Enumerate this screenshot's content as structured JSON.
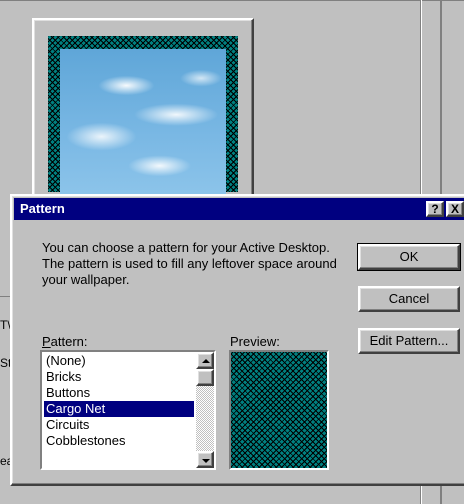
{
  "background": {
    "fragments": [
      "T\\",
      "St",
      "ea"
    ]
  },
  "dialog": {
    "title": "Pattern",
    "help_glyph": "?",
    "close_glyph": "X",
    "description": "You can choose a pattern for your Active Desktop.  The pattern is used to fill any leftover space around your wallpaper.",
    "buttons": {
      "ok": "OK",
      "cancel": "Cancel",
      "edit_pattern": "Edit Pattern..."
    },
    "pattern_label_first": "P",
    "pattern_label_rest": "attern:",
    "preview_label": "Preview:",
    "pattern_list": {
      "items": [
        "(None)",
        "Bricks",
        "Buttons",
        "Cargo Net",
        "Circuits",
        "Cobblestones"
      ],
      "selected": "Cargo Net"
    }
  },
  "colors": {
    "titlebar": "#000080",
    "face": "#c0c0c0",
    "pattern_teal": "#008080",
    "selection": "#000080"
  },
  "icons": [
    "help-icon",
    "close-icon",
    "scroll-up-icon",
    "scroll-down-icon"
  ]
}
